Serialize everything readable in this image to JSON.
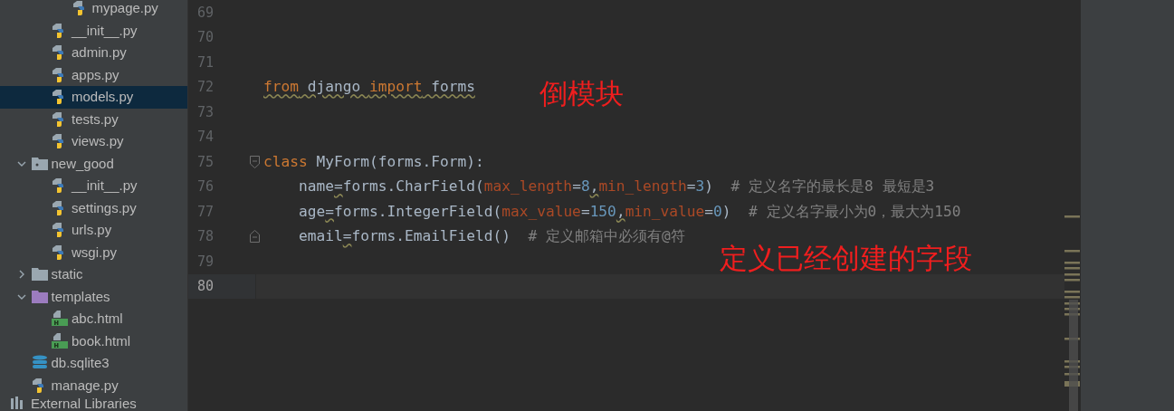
{
  "project_tree": [
    {
      "children": [
        {
          "children": [
            {
              "children": [
                {
                  "name": "mypage.py",
                  "kind": "python",
                  "selected": false
                }
              ]
            },
            {
              "name": "__init__.py",
              "kind": "python",
              "selected": false
            },
            {
              "name": "admin.py",
              "kind": "python",
              "selected": false
            },
            {
              "name": "apps.py",
              "kind": "python",
              "selected": false
            },
            {
              "name": "models.py",
              "kind": "python",
              "selected": true
            },
            {
              "name": "tests.py",
              "kind": "python",
              "selected": false
            },
            {
              "name": "views.py",
              "kind": "python",
              "selected": false
            }
          ]
        },
        {
          "name": "new_good",
          "kind": "package",
          "expanded": true,
          "selected": false,
          "children": [
            {
              "name": "__init__.py",
              "kind": "python",
              "selected": false
            },
            {
              "name": "settings.py",
              "kind": "python",
              "selected": false
            },
            {
              "name": "urls.py",
              "kind": "python",
              "selected": false
            },
            {
              "name": "wsgi.py",
              "kind": "python",
              "selected": false
            }
          ]
        },
        {
          "name": "static",
          "kind": "folder",
          "expanded": false,
          "selected": false
        },
        {
          "name": "templates",
          "kind": "template-folder",
          "expanded": true,
          "selected": false,
          "children": [
            {
              "name": "abc.html",
              "kind": "html",
              "selected": false
            },
            {
              "name": "book.html",
              "kind": "html",
              "selected": false
            }
          ]
        },
        {
          "name": "db.sqlite3",
          "kind": "database",
          "selected": false
        },
        {
          "name": "manage.py",
          "kind": "python",
          "selected": false
        }
      ]
    },
    {
      "name": "External Libraries",
      "kind": "libraries",
      "selected": false
    }
  ],
  "editor": {
    "lines": [
      {
        "number": "69",
        "current": false
      },
      {
        "number": "70",
        "current": false
      },
      {
        "number": "71",
        "current": false
      },
      {
        "number": "72",
        "current": false,
        "tokens": [
          {
            "kind": "keyword",
            "text": "from",
            "warning": true
          },
          {
            "kind": "plain",
            "text": " django ",
            "warning": true
          },
          {
            "kind": "keyword",
            "text": "import",
            "warning": true
          },
          {
            "kind": "plain",
            "text": " forms",
            "warning": true
          }
        ]
      },
      {
        "number": "73",
        "current": false
      },
      {
        "number": "74",
        "current": false
      },
      {
        "number": "75",
        "current": false,
        "fold_open": true,
        "tokens": [
          {
            "kind": "keyword",
            "text": "class"
          },
          {
            "kind": "plain",
            "text": " MyForm(forms.Form):"
          }
        ]
      },
      {
        "number": "76",
        "current": false,
        "tokens": [
          {
            "kind": "plain",
            "text": "    name"
          },
          {
            "kind": "plain",
            "text": "=",
            "warning": true
          },
          {
            "kind": "plain",
            "text": "forms.CharField("
          },
          {
            "kind": "param",
            "text": "max_length"
          },
          {
            "kind": "plain",
            "text": "="
          },
          {
            "kind": "number",
            "text": "8"
          },
          {
            "kind": "plain",
            "text": ",",
            "warning": true
          },
          {
            "kind": "param",
            "text": "min_length"
          },
          {
            "kind": "plain",
            "text": "="
          },
          {
            "kind": "number",
            "text": "3"
          },
          {
            "kind": "plain",
            "text": ")"
          },
          {
            "kind": "comment",
            "text": "  # 定义名字的最长是8 最短是3"
          }
        ]
      },
      {
        "number": "77",
        "current": false,
        "tokens": [
          {
            "kind": "plain",
            "text": "    age"
          },
          {
            "kind": "plain",
            "text": "=",
            "warning": true
          },
          {
            "kind": "plain",
            "text": "forms.IntegerField("
          },
          {
            "kind": "param",
            "text": "max_value"
          },
          {
            "kind": "plain",
            "text": "="
          },
          {
            "kind": "number",
            "text": "150"
          },
          {
            "kind": "plain",
            "text": ",",
            "warning": true
          },
          {
            "kind": "param",
            "text": "min_value"
          },
          {
            "kind": "plain",
            "text": "="
          },
          {
            "kind": "number",
            "text": "0"
          },
          {
            "kind": "plain",
            "text": ")"
          },
          {
            "kind": "comment",
            "text": "  # 定义名字最小为0，最大为150"
          }
        ]
      },
      {
        "number": "78",
        "current": false,
        "fold_close": true,
        "tokens": [
          {
            "kind": "plain",
            "text": "    email"
          },
          {
            "kind": "plain",
            "text": "=",
            "warning": true
          },
          {
            "kind": "plain",
            "text": "forms.EmailField()"
          },
          {
            "kind": "comment",
            "text": "  # 定义邮箱中必须有@符"
          }
        ]
      },
      {
        "number": "79",
        "current": false
      },
      {
        "number": "80",
        "current": true
      }
    ]
  },
  "annotations": [
    "倒模块",
    "定义已经创建的字段"
  ]
}
